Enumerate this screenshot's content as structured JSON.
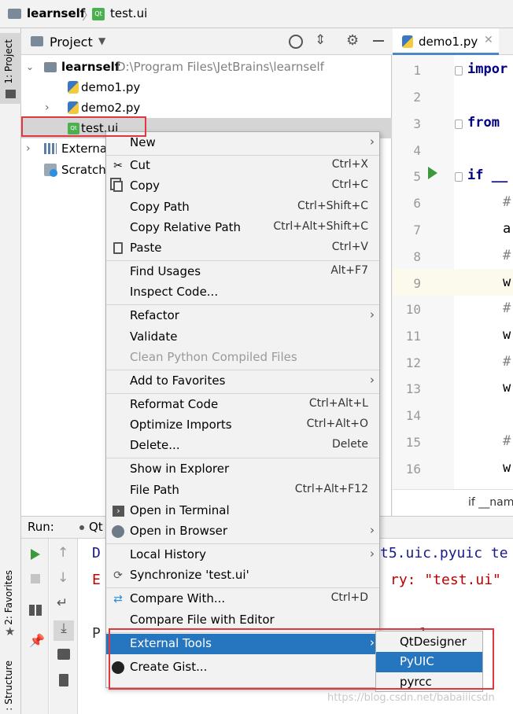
{
  "breadcrumb": {
    "project": "learnself",
    "file": "test.ui",
    "file_icon": "Qt"
  },
  "left_strip": {
    "project_tab": "1: Project",
    "favorites_tab": "2: Favorites",
    "structure_tab": ": Structure"
  },
  "project_panel": {
    "title": "Project",
    "tree": {
      "root_name": "learnself",
      "root_path": "D:\\Program Files\\JetBrains\\learnself",
      "files": [
        "demo1.py",
        "demo2.py",
        "test.ui"
      ],
      "external": "External",
      "scratches": "Scratche"
    }
  },
  "editor": {
    "tab_label": "demo1.py",
    "line_numbers": [
      "1",
      "2",
      "3",
      "4",
      "5",
      "6",
      "7",
      "8",
      "9",
      "10",
      "11",
      "12",
      "13",
      "14",
      "15",
      "16"
    ],
    "code": {
      "l1": "impor",
      "l3": "from",
      "l5": "if __",
      "l6": "#",
      "l7": "a",
      "l8": "#",
      "l9": "w",
      "l10": "#",
      "l11": "w",
      "l12": "#",
      "l13": "w",
      "l15": "#",
      "l16": "w"
    },
    "status": "if __nam"
  },
  "run_panel": {
    "label": "Run:",
    "tab": "Qt",
    "output": {
      "l1_a": "D",
      "l1_b": "t5.uic.pyuic te",
      "l2_a": "E",
      "l2_b": "ry: \"test.ui\"",
      "l3_a": "P",
      "l3_b": "1"
    }
  },
  "context_menu": {
    "items": [
      {
        "label": "New",
        "shortcut": "",
        "submenu": true
      },
      {
        "label": "Cut",
        "shortcut": "Ctrl+X",
        "icon": "scissors-icon"
      },
      {
        "label": "Copy",
        "shortcut": "Ctrl+C",
        "icon": "copy-icon"
      },
      {
        "label": "Copy Path",
        "shortcut": "Ctrl+Shift+C"
      },
      {
        "label": "Copy Relative Path",
        "shortcut": "Ctrl+Alt+Shift+C"
      },
      {
        "label": "Paste",
        "shortcut": "Ctrl+V",
        "icon": "clipboard-icon"
      },
      {
        "label": "Find Usages",
        "shortcut": "Alt+F7"
      },
      {
        "label": "Inspect Code...",
        "shortcut": ""
      },
      {
        "label": "Refactor",
        "shortcut": "",
        "submenu": true
      },
      {
        "label": "Validate",
        "shortcut": ""
      },
      {
        "label": "Clean Python Compiled Files",
        "shortcut": "",
        "disabled": true
      },
      {
        "label": "Add to Favorites",
        "shortcut": "",
        "submenu": true
      },
      {
        "label": "Reformat Code",
        "shortcut": "Ctrl+Alt+L"
      },
      {
        "label": "Optimize Imports",
        "shortcut": "Ctrl+Alt+O"
      },
      {
        "label": "Delete...",
        "shortcut": "Delete"
      },
      {
        "label": "Show in Explorer",
        "shortcut": ""
      },
      {
        "label": "File Path",
        "shortcut": "Ctrl+Alt+F12"
      },
      {
        "label": "Open in Terminal",
        "shortcut": "",
        "icon": "terminal-icon"
      },
      {
        "label": "Open in Browser",
        "shortcut": "",
        "submenu": true,
        "icon": "globe-icon"
      },
      {
        "label": "Local History",
        "shortcut": "",
        "submenu": true
      },
      {
        "label": "Synchronize 'test.ui'",
        "shortcut": "",
        "icon": "sync-icon"
      },
      {
        "label": "Compare With...",
        "shortcut": "Ctrl+D",
        "icon": "compare-icon"
      },
      {
        "label": "Compare File with Editor",
        "shortcut": ""
      },
      {
        "label": "External Tools",
        "shortcut": "",
        "submenu": true,
        "selected": true
      },
      {
        "label": "Create Gist...",
        "shortcut": "",
        "icon": "github-icon"
      }
    ]
  },
  "submenu": {
    "items": [
      "QtDesigner",
      "PyUIC",
      "pyrcc"
    ],
    "selected_index": 1
  },
  "watermark": "https://blog.csdn.net/babaiiicsdn",
  "colors": {
    "accent": "#2675bf",
    "highlight_box": "#e0383e",
    "run_green": "#3c9a3c"
  }
}
